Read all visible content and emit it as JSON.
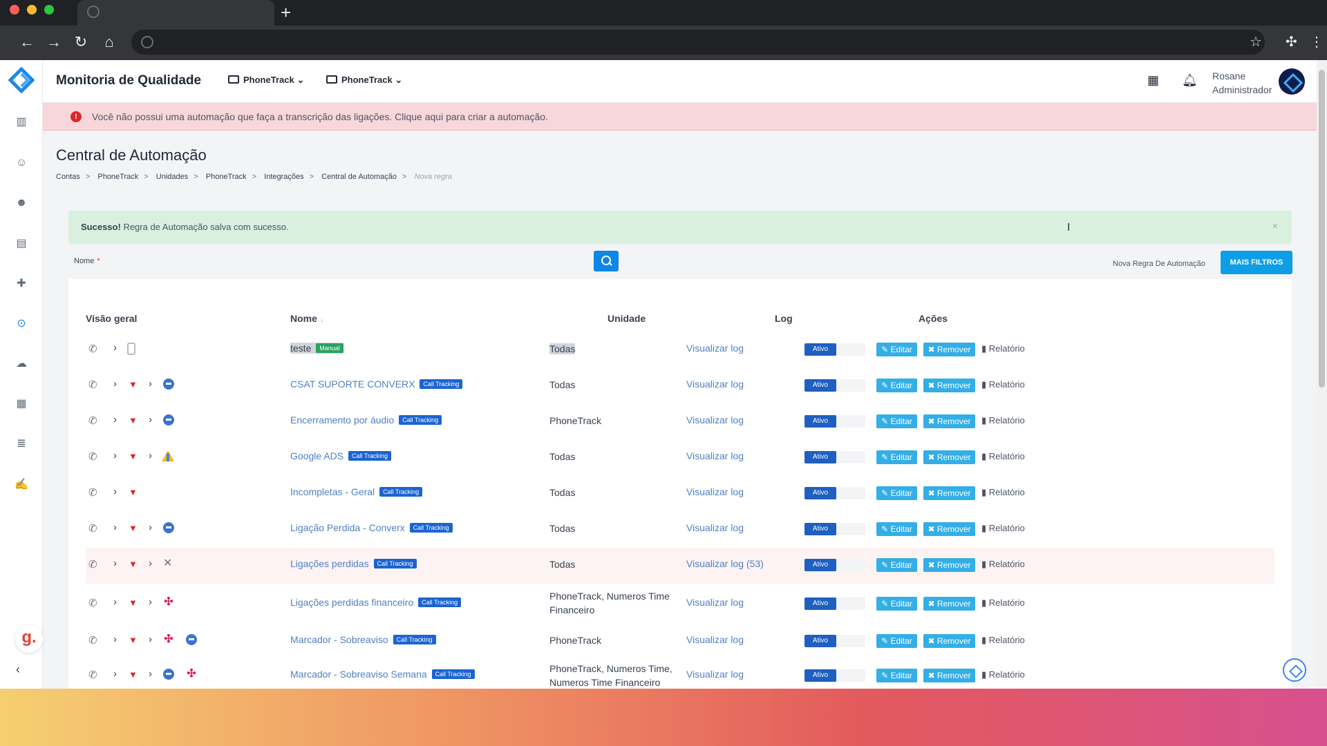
{
  "app": {
    "title": "Monitoria de Qualidade",
    "dropdowns": [
      "PhoneTrack",
      "PhoneTrack"
    ],
    "user": {
      "name": "Rosane",
      "role": "Administrador"
    }
  },
  "alert": {
    "icon": "!",
    "message": "Você não possui uma automação que faça a transcrição das ligações. Clique aqui para criar a automação."
  },
  "page": {
    "title": "Central de Automação",
    "breadcrumb": [
      "Contas",
      "PhoneTrack",
      "Unidades",
      "PhoneTrack",
      "Integrações",
      "Central de Automação",
      "Nova regra"
    ]
  },
  "success": {
    "title": "Sucesso!",
    "message": "Regra de Automação salva com sucesso."
  },
  "filters": {
    "name_label": "Nome",
    "required_mark": "*",
    "new_rule_link": "Nova Regra De Automação",
    "more_filters": "MAIS FILTROS"
  },
  "table": {
    "headers": {
      "overview": "Visão geral",
      "name": "Nome",
      "name_sort": "↓",
      "unit": "Unidade",
      "log": "Log",
      "actions": "Ações"
    },
    "rows": [
      {
        "name": "teste",
        "badge": "Manual",
        "unit": "Todas",
        "log": "Visualizar log",
        "status": "Ativo"
      },
      {
        "name": "CSAT SUPORTE CONVERX",
        "badge": "Call Tracking",
        "unit": "Todas",
        "log": "Visualizar log",
        "status": "Ativo"
      },
      {
        "name": "Encerramento por áudio",
        "badge": "Call Tracking",
        "unit": "PhoneTrack",
        "log": "Visualizar log",
        "status": "Ativo"
      },
      {
        "name": "Google ADS",
        "badge": "Call Tracking",
        "unit": "Todas",
        "log": "Visualizar log",
        "status": "Ativo"
      },
      {
        "name": "Incompletas - Geral",
        "badge": "Call Tracking",
        "unit": "Todas",
        "log": "Visualizar log",
        "status": "Ativo"
      },
      {
        "name": "Ligação Perdida - Converx",
        "badge": "Call Tracking",
        "unit": "Todas",
        "log": "Visualizar log",
        "status": "Ativo"
      },
      {
        "name": "Ligações perdidas",
        "badge": "Call Tracking",
        "unit": "Todas",
        "log": "Visualizar log (53)",
        "status": "Ativo"
      },
      {
        "name": "Ligações perdidas financeiro",
        "badge": "Call Tracking",
        "unit": "PhoneTrack, Numeros Time Financeiro",
        "log": "Visualizar log",
        "status": "Ativo"
      },
      {
        "name": "Marcador - Sobreaviso",
        "badge": "Call Tracking",
        "unit": "PhoneTrack",
        "log": "Visualizar log",
        "status": "Ativo"
      },
      {
        "name": "Marcador - Sobreaviso Semana",
        "badge": "Call Tracking",
        "unit": "PhoneTrack, Numeros Time, Numeros Time Financeiro",
        "log": "Visualizar log",
        "status": "Ativo"
      }
    ],
    "action_labels": {
      "edit": "Editar",
      "remove": "Remover",
      "report": "Relatório"
    }
  },
  "side_badge": "g."
}
